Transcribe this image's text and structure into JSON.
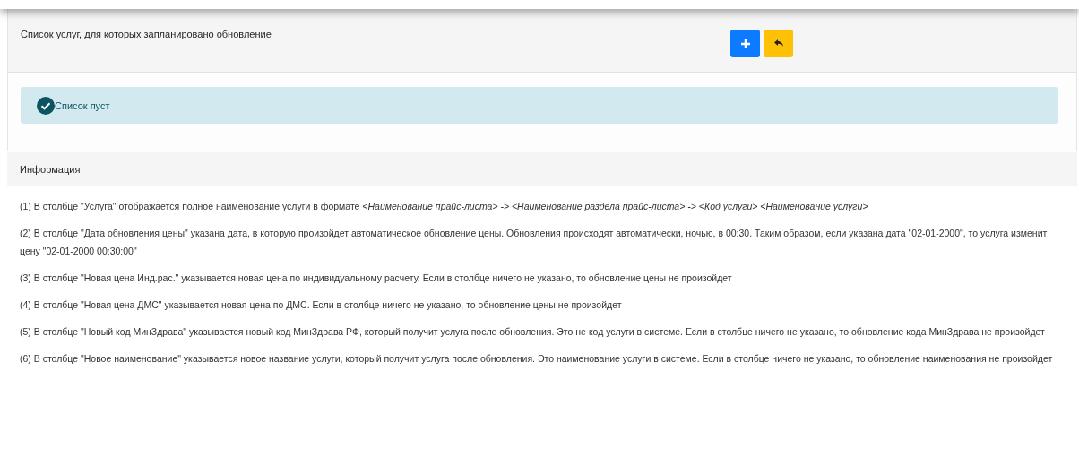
{
  "services_card": {
    "title": "Список услуг, для которых запланировано обновление",
    "buttons": [
      {
        "kind": "add"
      },
      {
        "kind": "back"
      }
    ],
    "alert": {
      "kind": "success",
      "text": "Список пуст"
    }
  },
  "info_card": {
    "title": "Информация",
    "notes": [
      "(1) В столбце \"Услуга\" отображается полное наименование услуги в формате *<Наименование прайс-листа> -> <Наименование раздела прайс-листа> -> <Код услуги> <Наименование услуги>*",
      "(2) В столбце \"Дата обновления цены\" указана дата, в которую произойдет автоматическое обновление цены. Обновления происходят автоматически, ночью, в 00:30. Таким образом, если указана дата \"02-01-2000\", то услуга изменит цену \"02-01-2000 00:30:00\"",
      "(3) В столбце \"Новая цена Инд.рас.\" указывается новая цена по индивидуальному расчету. Если в столбце ничего не указано, то обновление цены не произойдет",
      "(4) В столбце \"Новая цена ДМС\" указывается новая цена по ДМС. Если в столбце ничего не указано, то обновление цены не произойдет",
      "(5) В столбце \"Новый код МинЗдрава\" указывается новый код МинЗдрава РФ, который получит услуга после обновления. Это не код услуги в системе. Если в столбце ничего не указано, то обновление кода МинЗдрава не произойдет",
      "(6) В столбце \"Новое наименование\" указывается новое название услуги, который получит услуга после обновления. Это наименование услуги в системе. Если в столбце ничего не указано, то обновление наименования не произойдет"
    ]
  }
}
